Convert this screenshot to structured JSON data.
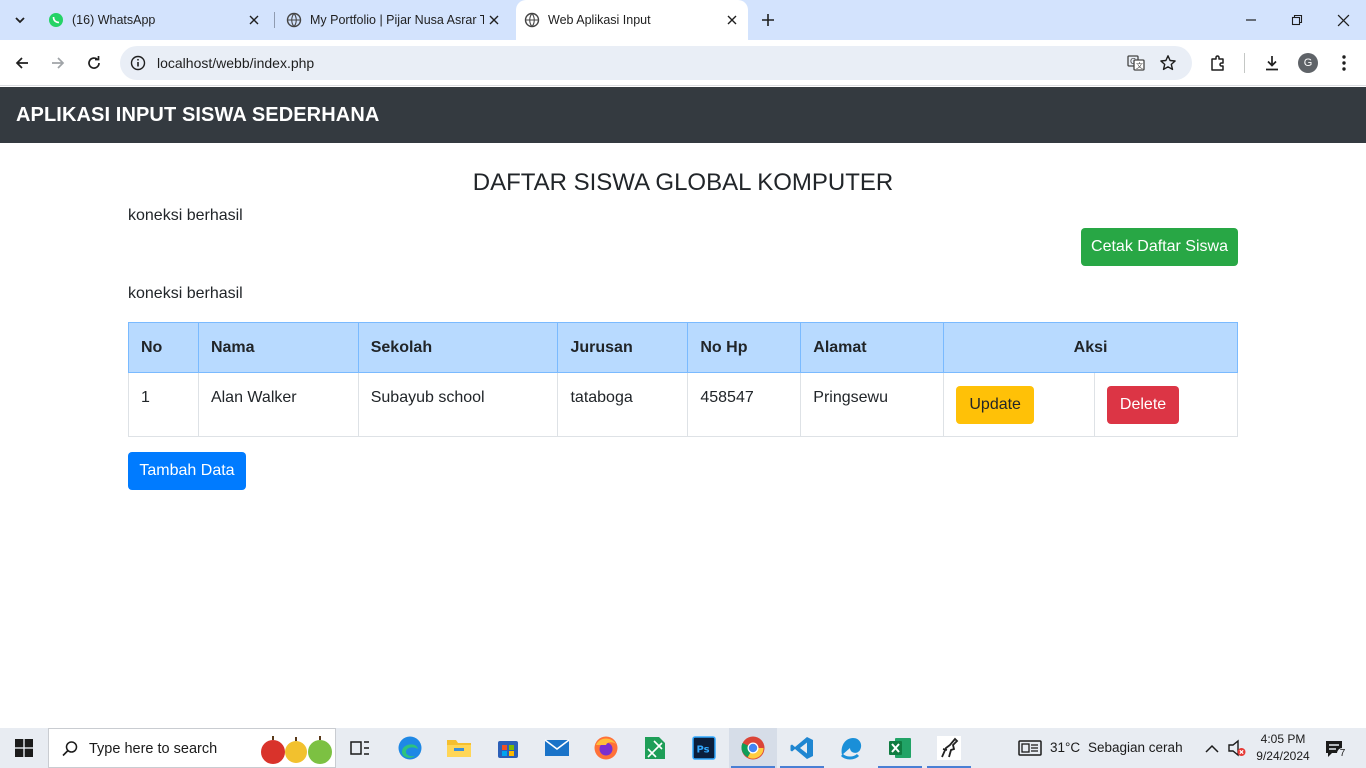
{
  "browser": {
    "tabs": [
      {
        "title": "(16) WhatsApp",
        "icon": "whatsapp-icon"
      },
      {
        "title": "My Portfolio | Pijar Nusa Asrar T",
        "icon": "globe-icon"
      },
      {
        "title": "Web Aplikasi Input",
        "icon": "globe-icon",
        "active": true
      }
    ],
    "url": "localhost/webb/index.php",
    "profile_initial": "G"
  },
  "page": {
    "brand": "APLIKASI INPUT SISWA SEDERHANA",
    "title": "DAFTAR SISWA GLOBAL KOMPUTER",
    "connection_msg_1": "koneksi berhasil",
    "connection_msg_2": "koneksi berhasil",
    "print_button": "Cetak Daftar Siswa",
    "add_button": "Tambah Data",
    "table": {
      "headers": [
        "No",
        "Nama",
        "Sekolah",
        "Jurusan",
        "No Hp",
        "Alamat",
        "Aksi"
      ],
      "rows": [
        {
          "no": "1",
          "nama": "Alan Walker",
          "sekolah": "Subayub school",
          "jurusan": "tataboga",
          "nohp": "458547",
          "alamat": "Pringsewu",
          "update": "Update",
          "delete": "Delete"
        }
      ]
    },
    "colors": {
      "navbar": "#343a40",
      "print": "#28a745",
      "add": "#007bff",
      "update": "#ffc107",
      "delete": "#dc3545",
      "thead": "#b8daff"
    }
  },
  "taskbar": {
    "search_placeholder": "Type here to search",
    "weather_temp": "31°C",
    "weather_desc": "Sebagian cerah",
    "time": "4:05 PM",
    "date": "9/24/2024",
    "notification_count": "7"
  }
}
